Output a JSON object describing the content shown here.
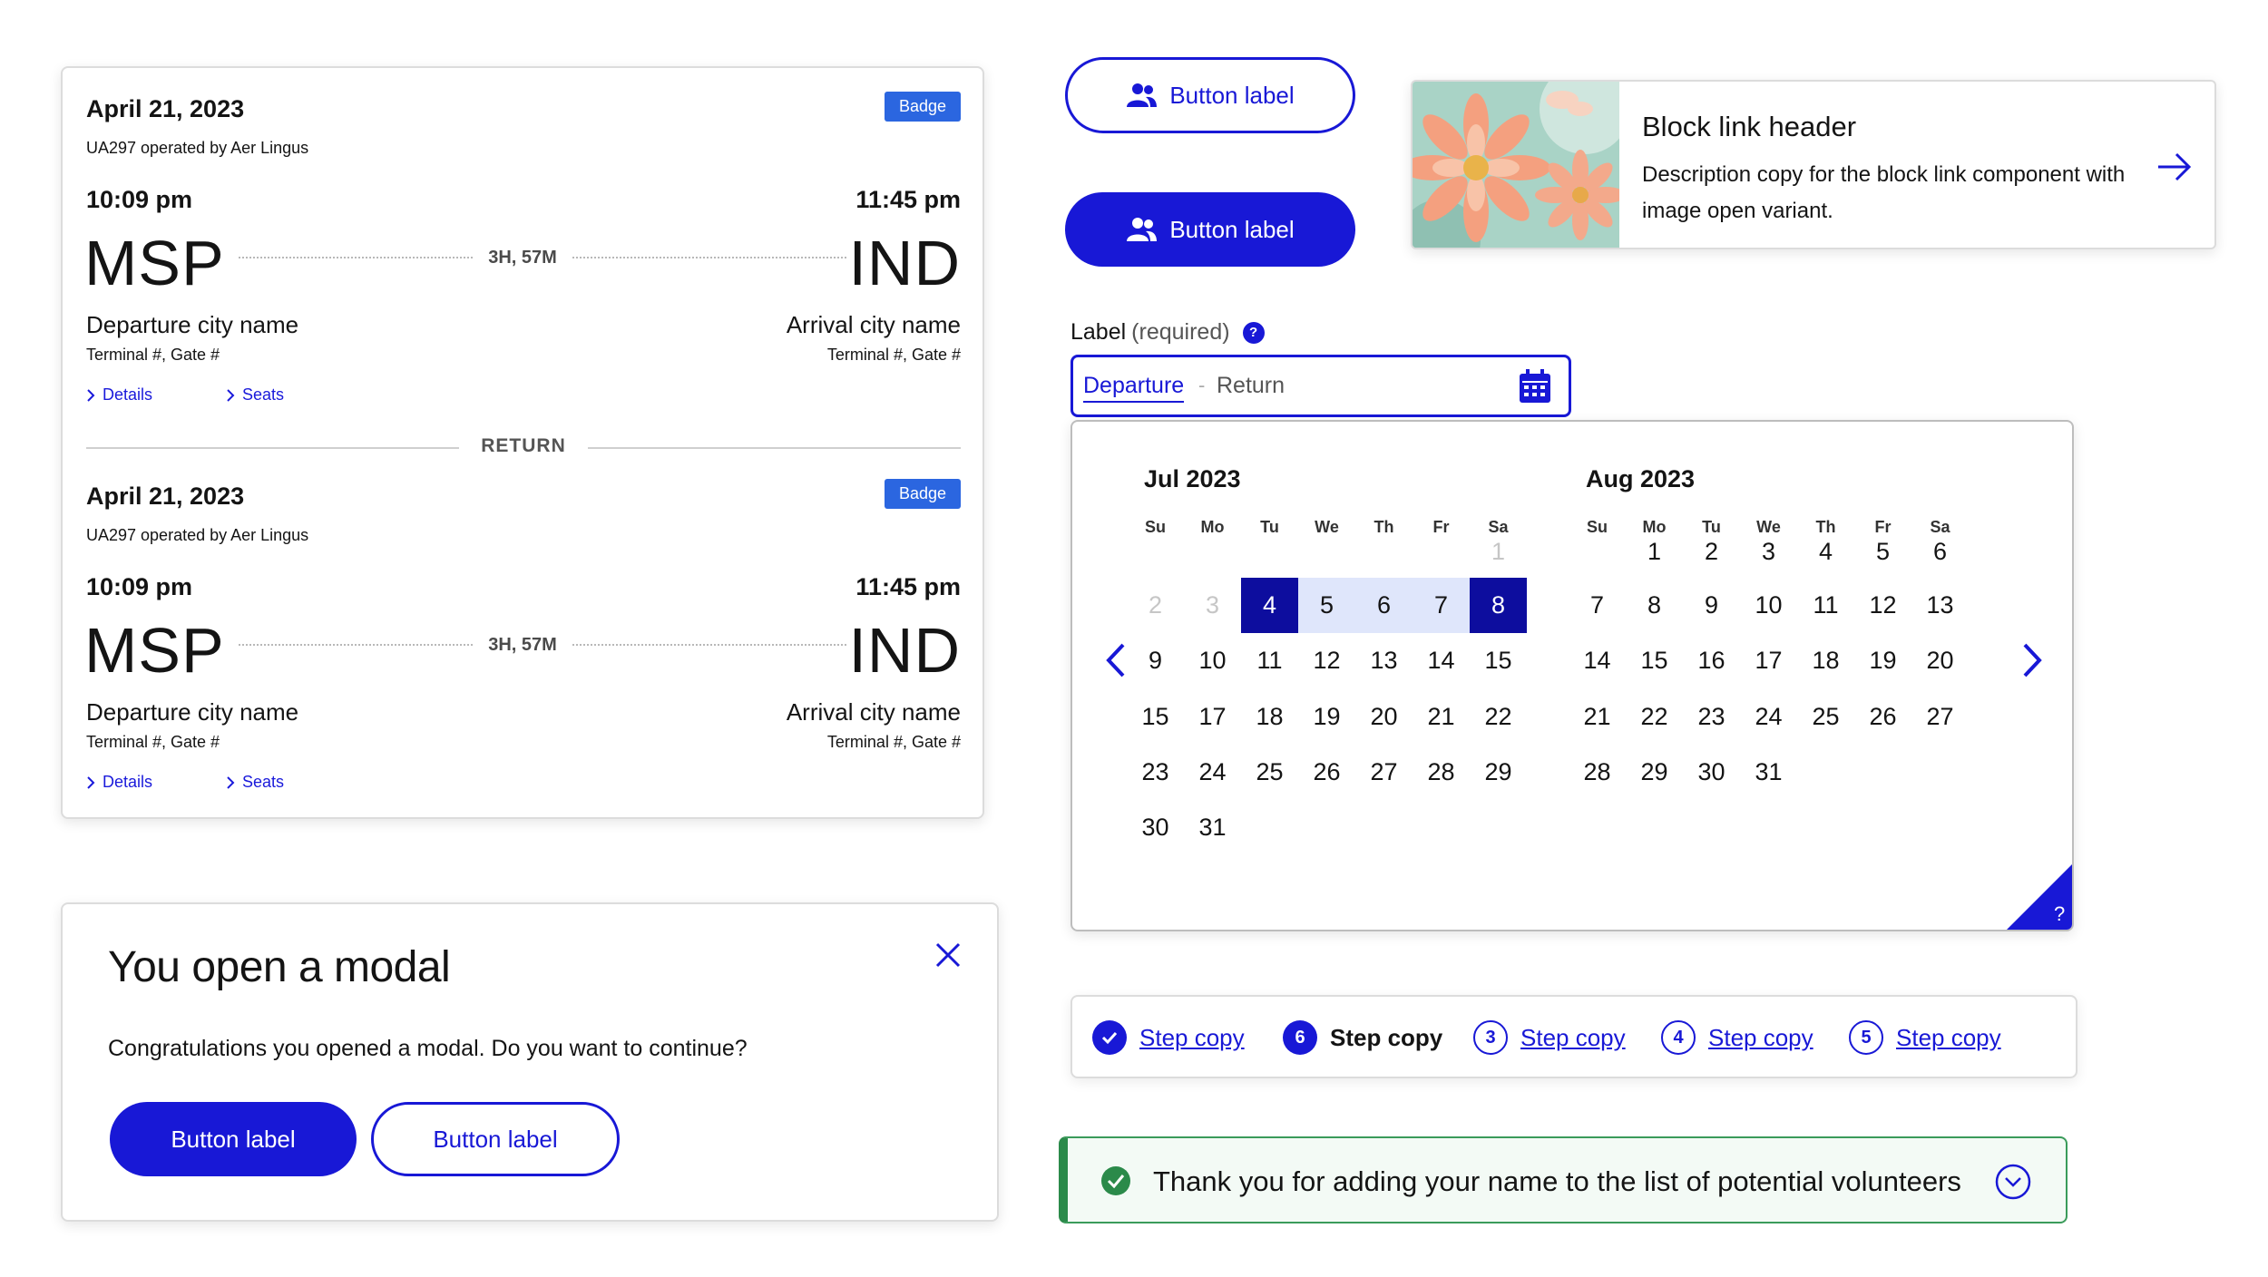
{
  "flight": {
    "outbound": {
      "date": "April 21, 2023",
      "operator": "UA297 operated by Aer Lingus",
      "badge": "Badge",
      "depart_time": "10:09 pm",
      "arrive_time": "11:45 pm",
      "depart_code": "MSP",
      "arrive_code": "IND",
      "duration": "3H, 57M",
      "depart_city": "Departure city name",
      "arrive_city": "Arrival city name",
      "depart_terminal": "Terminal #, Gate #",
      "arrive_terminal": "Terminal #, Gate #",
      "details_link": "Details",
      "seats_link": "Seats"
    },
    "divider_label": "RETURN",
    "return": {
      "date": "April 21, 2023",
      "operator": "UA297 operated by Aer Lingus",
      "badge": "Badge",
      "depart_time": "10:09 pm",
      "arrive_time": "11:45 pm",
      "depart_code": "MSP",
      "arrive_code": "IND",
      "duration": "3H, 57M",
      "depart_city": "Departure city name",
      "arrive_city": "Arrival city name",
      "depart_terminal": "Terminal #, Gate #",
      "arrive_terminal": "Terminal #, Gate #",
      "details_link": "Details",
      "seats_link": "Seats"
    }
  },
  "modal": {
    "title": "You open a modal",
    "body": "Congratulations you opened a modal. Do you want to continue?",
    "primary_label": "Button label",
    "secondary_label": "Button label"
  },
  "buttons": {
    "outline_label": "Button label",
    "solid_label": "Button label"
  },
  "block_link": {
    "header": "Block link header",
    "description": "Description copy for the block link component with image open variant."
  },
  "date_field": {
    "label": "Label",
    "required": "(required)",
    "help": "?",
    "departure": "Departure",
    "separator": "-",
    "return": "Return"
  },
  "calendar": {
    "weekdays": [
      "Su",
      "Mo",
      "Tu",
      "We",
      "Th",
      "Fr",
      "Sa"
    ],
    "months": [
      {
        "title": "Jul 2023",
        "rows": [
          [
            "",
            "",
            "",
            "",
            "",
            "",
            "1"
          ],
          [
            "2",
            "3",
            "4",
            "5",
            "6",
            "7",
            "8"
          ],
          [
            "9",
            "10",
            "11",
            "12",
            "13",
            "14",
            "15"
          ],
          [
            "15",
            "17",
            "18",
            "19",
            "20",
            "21",
            "22"
          ],
          [
            "23",
            "24",
            "25",
            "26",
            "27",
            "28",
            "29"
          ],
          [
            "30",
            "31",
            "",
            "",
            "",
            "",
            ""
          ]
        ],
        "disabled": [
          "1",
          "2",
          "3"
        ],
        "selected": [
          "4",
          "8"
        ],
        "in_range": [
          "5",
          "6",
          "7"
        ]
      },
      {
        "title": "Aug 2023",
        "rows": [
          [
            "",
            "1",
            "2",
            "3",
            "4",
            "5",
            "6"
          ],
          [
            "7",
            "8",
            "9",
            "10",
            "11",
            "12",
            "13"
          ],
          [
            "14",
            "15",
            "16",
            "17",
            "18",
            "19",
            "20"
          ],
          [
            "21",
            "22",
            "23",
            "24",
            "25",
            "26",
            "27"
          ],
          [
            "28",
            "29",
            "30",
            "31",
            "",
            "",
            ""
          ]
        ],
        "disabled": [],
        "selected": [],
        "in_range": []
      }
    ],
    "corner_help": "?"
  },
  "stepper": {
    "steps": [
      {
        "number": "",
        "label": "Step copy",
        "state": "done"
      },
      {
        "number": "6",
        "label": "Step copy",
        "state": "current"
      },
      {
        "number": "3",
        "label": "Step copy",
        "state": "todo"
      },
      {
        "number": "4",
        "label": "Step copy",
        "state": "todo"
      },
      {
        "number": "5",
        "label": "Step copy",
        "state": "todo"
      }
    ]
  },
  "notification": {
    "message": "Thank you for adding your name to the list of potential volunteers"
  },
  "colors": {
    "primary": "#1818d6",
    "selected_day": "#0d0d9e",
    "range_day": "#dfe6fb",
    "badge": "#2b66e0",
    "success": "#2b8a4a"
  },
  "icons": {
    "people": "people-icon",
    "calendar": "calendar-icon",
    "close": "close-icon",
    "arrow": "arrow-right-icon",
    "check": "check-circle-icon",
    "chevron": "chevron-down-icon"
  }
}
